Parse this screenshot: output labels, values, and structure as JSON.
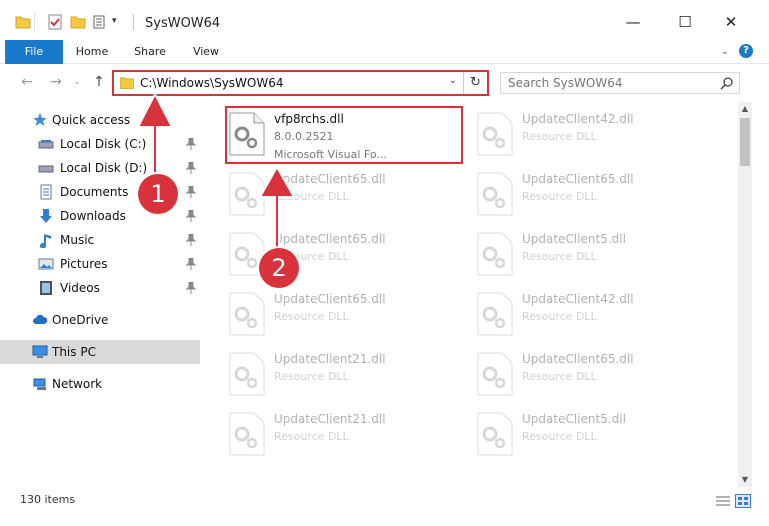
{
  "window": {
    "title": "SysWOW64"
  },
  "ribbon": {
    "tabs": [
      {
        "label": "File"
      },
      {
        "label": "Home"
      },
      {
        "label": "Share"
      },
      {
        "label": "View"
      }
    ],
    "help_label": "?"
  },
  "nav": {
    "address": "C:\\Windows\\SysWOW64",
    "search_placeholder": "Search SysWOW64"
  },
  "sidebar": {
    "items": [
      {
        "label": "Quick access",
        "icon": "star-icon",
        "pinned": false
      },
      {
        "label": "Local Disk (C:)",
        "icon": "drive-icon",
        "pinned": true
      },
      {
        "label": "Local Disk (D:)",
        "icon": "drive-icon",
        "pinned": true
      },
      {
        "label": "Documents",
        "icon": "documents-icon",
        "pinned": true
      },
      {
        "label": "Downloads",
        "icon": "download-icon",
        "pinned": true
      },
      {
        "label": "Music",
        "icon": "music-icon",
        "pinned": true
      },
      {
        "label": "Pictures",
        "icon": "pictures-icon",
        "pinned": true
      },
      {
        "label": "Videos",
        "icon": "videos-icon",
        "pinned": true
      },
      {
        "label": "OneDrive",
        "icon": "cloud-icon",
        "pinned": false
      },
      {
        "label": "This PC",
        "icon": "computer-icon",
        "pinned": false,
        "selected": true
      },
      {
        "label": "Network",
        "icon": "network-icon",
        "pinned": false
      }
    ]
  },
  "files": {
    "highlighted": {
      "name": "vfp8rchs.dll",
      "version": "8.0.0.2521",
      "company": "Microsoft Visual Fo..."
    },
    "column1": [
      {
        "name": "UpdateClient65.dll",
        "type": "Resource DLL"
      },
      {
        "name": "UpdateClient65.dll",
        "type": "Resource DLL"
      },
      {
        "name": "UpdateClient65.dll",
        "type": "Resource DLL"
      },
      {
        "name": "UpdateClient21.dll",
        "type": "Resource DLL"
      },
      {
        "name": "UpdateClient21.dll",
        "type": "Resource DLL"
      }
    ],
    "column2": [
      {
        "name": "UpdateClient42.dll",
        "type": "Resource DLL"
      },
      {
        "name": "UpdateClient65.dll",
        "type": "Resource DLL"
      },
      {
        "name": "UpdateClient5.dll",
        "type": "Resource DLL"
      },
      {
        "name": "UpdateClient42.dll",
        "type": "Resource DLL"
      },
      {
        "name": "UpdateClient65.dll",
        "type": "Resource DLL"
      },
      {
        "name": "UpdateClient5.dll",
        "type": "Resource DLL"
      }
    ]
  },
  "status": {
    "item_count": "130 items"
  },
  "annotations": {
    "marker1": "1",
    "marker2": "2"
  },
  "colors": {
    "accent": "#1979ca",
    "annotation": "#d8323c"
  }
}
